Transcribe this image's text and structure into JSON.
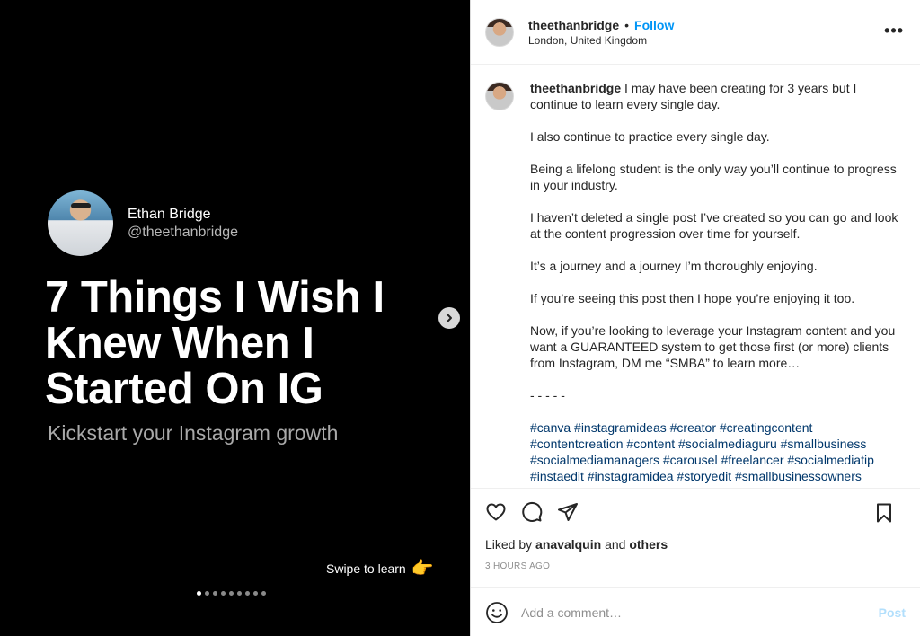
{
  "slide": {
    "author_name": "Ethan Bridge",
    "author_handle": "@theethanbridge",
    "headline": "7 Things I Wish I Knew When I Started On IG",
    "subline": "Kickstart your Instagram growth",
    "swipe_text": "Swipe to learn",
    "swipe_icon": "pointing-hand-emoji",
    "total_slides": 9,
    "current_slide": 1
  },
  "header": {
    "username": "theethanbridge",
    "separator": "•",
    "follow_label": "Follow",
    "location": "London, United Kingdom",
    "more_icon": "more-options-icon"
  },
  "caption": {
    "username": "theethanbridge",
    "first_line": "I may have been creating for 3 years but I continue to learn every single day.",
    "paragraphs": [
      "I also continue to practice every single day.",
      "Being a lifelong student is the only way you’ll continue to progress in your industry.",
      "I haven’t deleted a single post I’ve created so you can go and look at the content progression over time for yourself.",
      "It’s a journey and a journey I’m thoroughly enjoying.",
      "If you’re seeing this post then I hope you’re enjoying it too.",
      "Now, if you’re looking to leverage your Instagram content and you want a GUARANTEED system to get those first (or more) clients from Instagram, DM me “SMBA” to learn more…",
      "- - - - -"
    ],
    "hashtags": "#canva #instagramideas #creator #creatingcontent #contentcreation #content #socialmediaguru #smallbusiness #socialmediamanagers #carousel #freelancer #socialmediatip #instaedit #instagramidea #storyedit #smallbusinessowners"
  },
  "likes": {
    "prefix": "Liked by",
    "user": "anavalquin",
    "conj": "and",
    "others": "others"
  },
  "timestamp": "3 HOURS AGO",
  "comment_box": {
    "placeholder": "Add a comment…",
    "post_label": "Post"
  },
  "colors": {
    "follow": "#0095f6",
    "hashtag": "#00376b",
    "post_disabled": "#b2dffc"
  }
}
